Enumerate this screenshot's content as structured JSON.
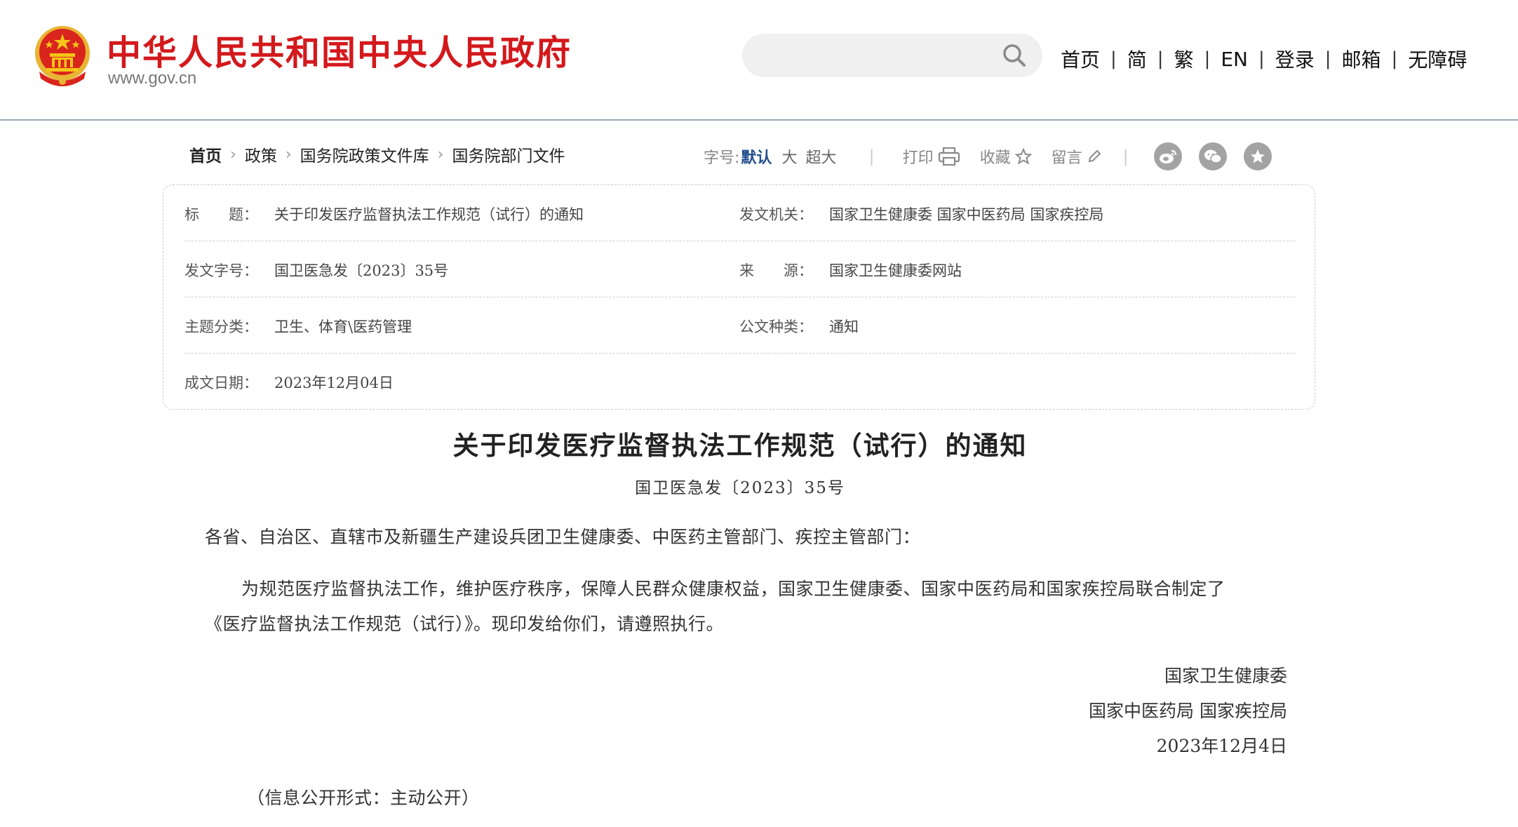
{
  "header": {
    "site_name": "中华人民共和国中央人民政府",
    "site_url": "www.gov.cn",
    "search_placeholder": "",
    "nav": [
      "首页",
      "简",
      "繁",
      "EN",
      "登录",
      "邮箱",
      "无障碍"
    ],
    "nav_separator": "|",
    "brand_color": "#d3191c"
  },
  "breadcrumb": {
    "items": [
      "首页",
      "政策",
      "国务院政策文件库",
      "国务院部门文件"
    ],
    "separator": "›"
  },
  "toolbar": {
    "font_size_label": "字号:",
    "font_size_options": [
      "默认",
      "大",
      "超大"
    ],
    "separator": "|",
    "print_label": "打印",
    "favorite_label": "收藏",
    "comment_label": "留言",
    "share_icons": [
      "weibo-icon",
      "wechat-icon",
      "qzone-icon"
    ]
  },
  "info": {
    "title_label": "标　　题：",
    "title_value": "关于印发医疗监督执法工作规范（试行）的通知",
    "issuer_label": "发文机关：",
    "issuer_value": "国家卫生健康委 国家中医药局 国家疾控局",
    "doc_no_label": "发文字号：",
    "doc_no_value": "国卫医急发〔2023〕35号",
    "source_label": "来　　源：",
    "source_value": "国家卫生健康委网站",
    "category_label": "主题分类：",
    "category_value": "卫生、体育\\医药管理",
    "doc_type_label": "公文种类：",
    "doc_type_value": "通知",
    "date_label": "成文日期：",
    "date_value": "2023年12月04日"
  },
  "article": {
    "title": "关于印发医疗监督执法工作规范（试行）的通知",
    "doc_number": "国卫医急发〔2023〕35号",
    "salutation": "各省、自治区、直辖市及新疆生产建设兵团卫生健康委、中医药主管部门、疾控主管部门：",
    "paragraph_line1": "为规范医疗监督执法工作，维护医疗秩序，保障人民群众健康权益，国家卫生健康委、国家中医药局和国家疾控局联合制定了",
    "paragraph_line2": "《医疗监督执法工作规范（试行）》。现印发给你们，请遵照执行。",
    "sign_line1": "国家卫生健康委",
    "sign_line2": "国家中医药局 国家疾控局",
    "sign_date": "2023年12月4日",
    "disclosure": "（信息公开形式：主动公开）"
  }
}
